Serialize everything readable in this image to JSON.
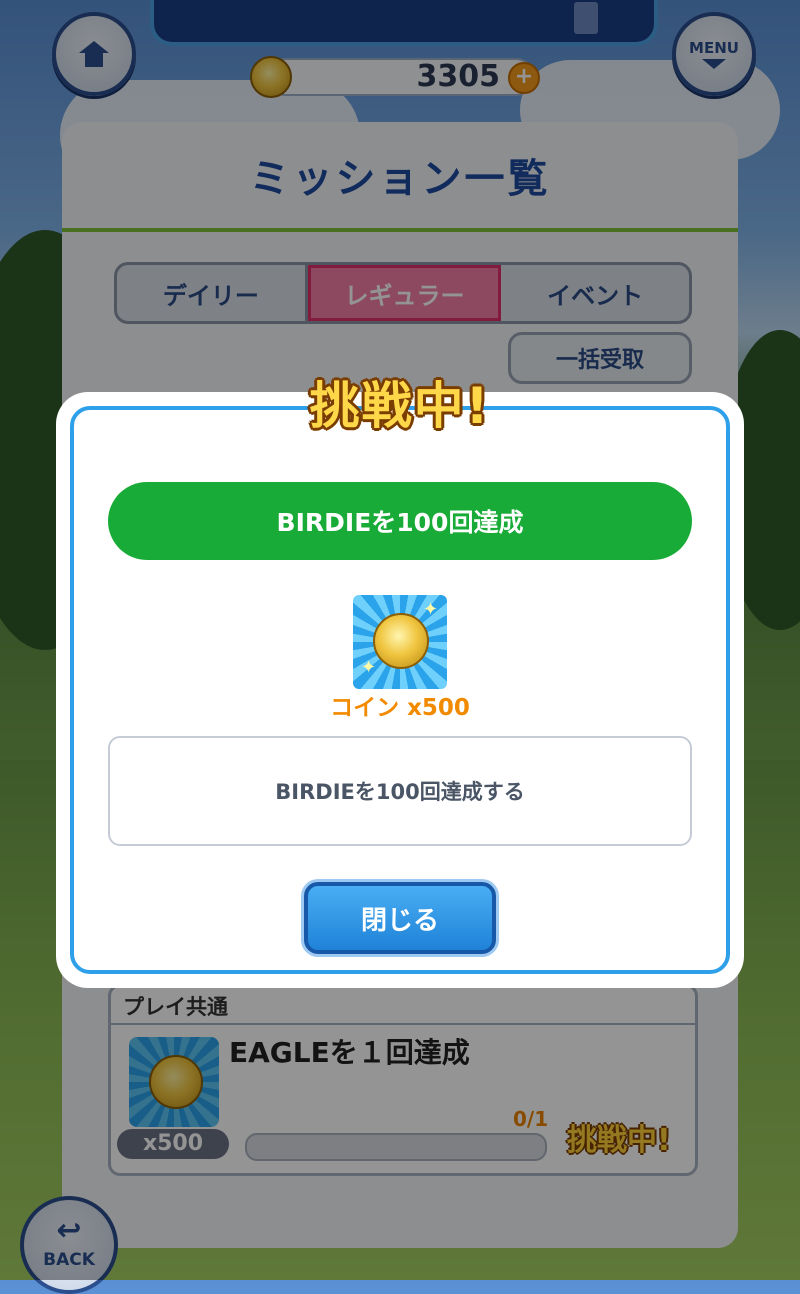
{
  "header": {
    "coins": "3305",
    "plus_label": "+",
    "menu_label": "MENU"
  },
  "panel": {
    "title": "ミッション一覧",
    "tabs": [
      {
        "label": "デイリー"
      },
      {
        "label": "レギュラー"
      },
      {
        "label": "イベント"
      }
    ],
    "active_tab": "レギュラー",
    "bulk_receive_label": "一括受取",
    "mission": {
      "category": "プレイ共通",
      "name": "EAGLEを１回達成",
      "reward_qty": "x500",
      "progress_text": "0/1",
      "progress": 0,
      "status": "挑戦中!"
    }
  },
  "modal": {
    "title": "挑戦中!",
    "mission_name": "BIRDIEを100回達成",
    "reward_label": "コイン x500",
    "description": "BIRDIEを100回達成する",
    "close_label": "閉じる"
  },
  "footer": {
    "back_label": "BACK",
    "back_icon": "↩"
  },
  "colors": {
    "accent_green": "#19ab37",
    "accent_blue": "#2ea0ea",
    "reward_orange": "#f28a00",
    "active_tab_pink": "#f27fa6"
  }
}
